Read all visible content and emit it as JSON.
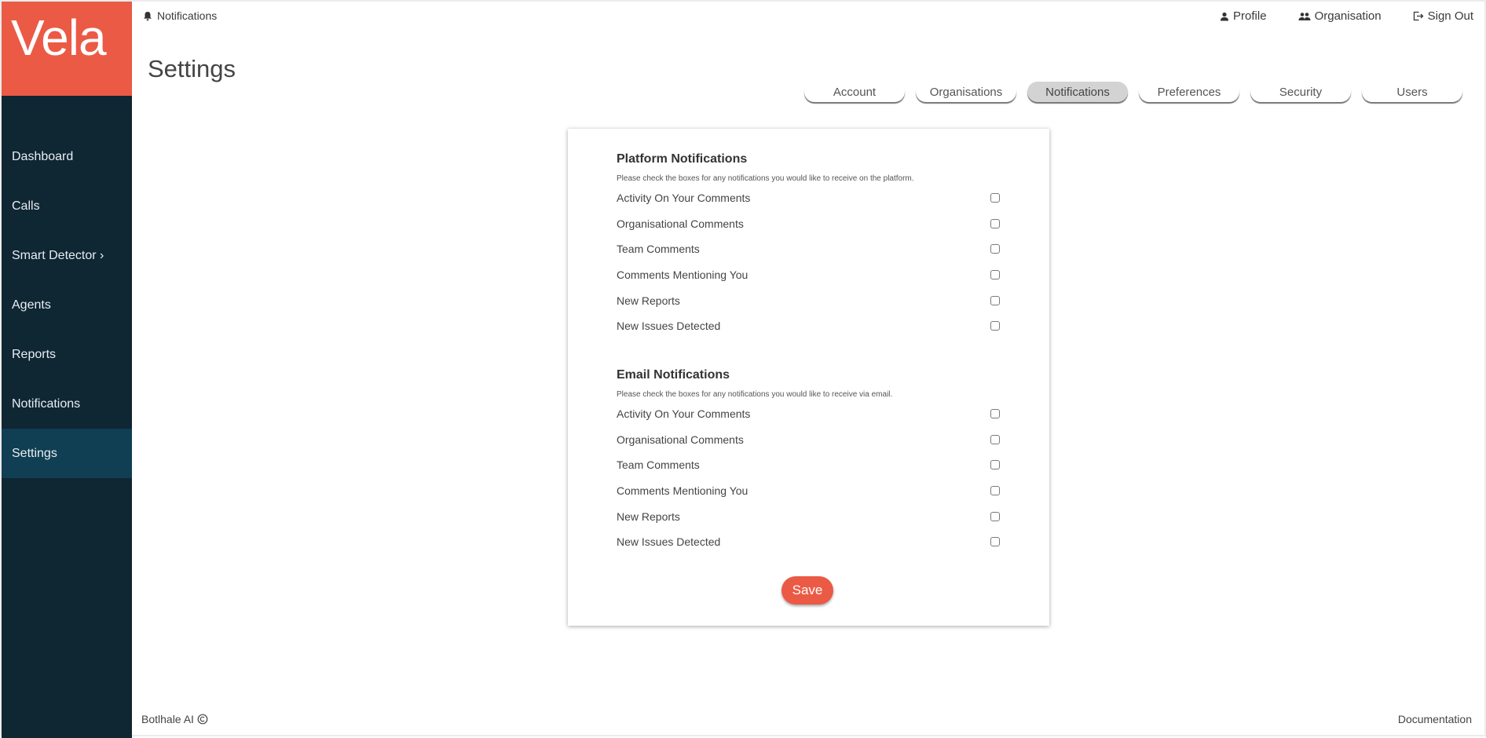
{
  "brand": {
    "logo_text": "Vela",
    "accent": "#eb5a45",
    "sidebar_bg": "#0f2633",
    "sidebar_active_bg": "#103e52"
  },
  "topbar": {
    "left": {
      "icon": "bell-icon",
      "label": "Notifications"
    },
    "right": [
      {
        "icon": "person-icon",
        "label": "Profile"
      },
      {
        "icon": "group-icon",
        "label": "Organisation"
      },
      {
        "icon": "sign-out-icon",
        "label": "Sign Out"
      }
    ]
  },
  "page": {
    "title": "Settings"
  },
  "sidebar": {
    "items": [
      {
        "label": "Dashboard",
        "active": false
      },
      {
        "label": "Calls",
        "active": false
      },
      {
        "label": "Smart Detector ›",
        "active": false
      },
      {
        "label": "Agents",
        "active": false
      },
      {
        "label": "Reports",
        "active": false
      },
      {
        "label": "Notifications",
        "active": false
      },
      {
        "label": "Settings",
        "active": true
      }
    ]
  },
  "tabs": [
    {
      "label": "Account",
      "active": false
    },
    {
      "label": "Organisations",
      "active": false
    },
    {
      "label": "Notifications",
      "active": true
    },
    {
      "label": "Preferences",
      "active": false
    },
    {
      "label": "Security",
      "active": false
    },
    {
      "label": "Users",
      "active": false
    }
  ],
  "platform": {
    "title": "Platform Notifications",
    "description": "Please check the boxes for any notifications you would like to receive on the platform.",
    "options": [
      {
        "label": "Activity On Your Comments",
        "checked": false
      },
      {
        "label": "Organisational Comments",
        "checked": false
      },
      {
        "label": "Team Comments",
        "checked": false
      },
      {
        "label": "Comments Mentioning You",
        "checked": false
      },
      {
        "label": "New Reports",
        "checked": false
      },
      {
        "label": "New Issues Detected",
        "checked": false
      }
    ]
  },
  "email": {
    "title": "Email Notifications",
    "description": "Please check the boxes for any notifications you would like to receive via email.",
    "options": [
      {
        "label": "Activity On Your Comments",
        "checked": false
      },
      {
        "label": "Organisational Comments",
        "checked": false
      },
      {
        "label": "Team Comments",
        "checked": false
      },
      {
        "label": "Comments Mentioning You",
        "checked": false
      },
      {
        "label": "New Reports",
        "checked": false
      },
      {
        "label": "New Issues Detected",
        "checked": false
      }
    ]
  },
  "save_label": "Save",
  "footer": {
    "left": "Botlhale AI",
    "left_icon": "copyright-icon",
    "right": "Documentation"
  }
}
